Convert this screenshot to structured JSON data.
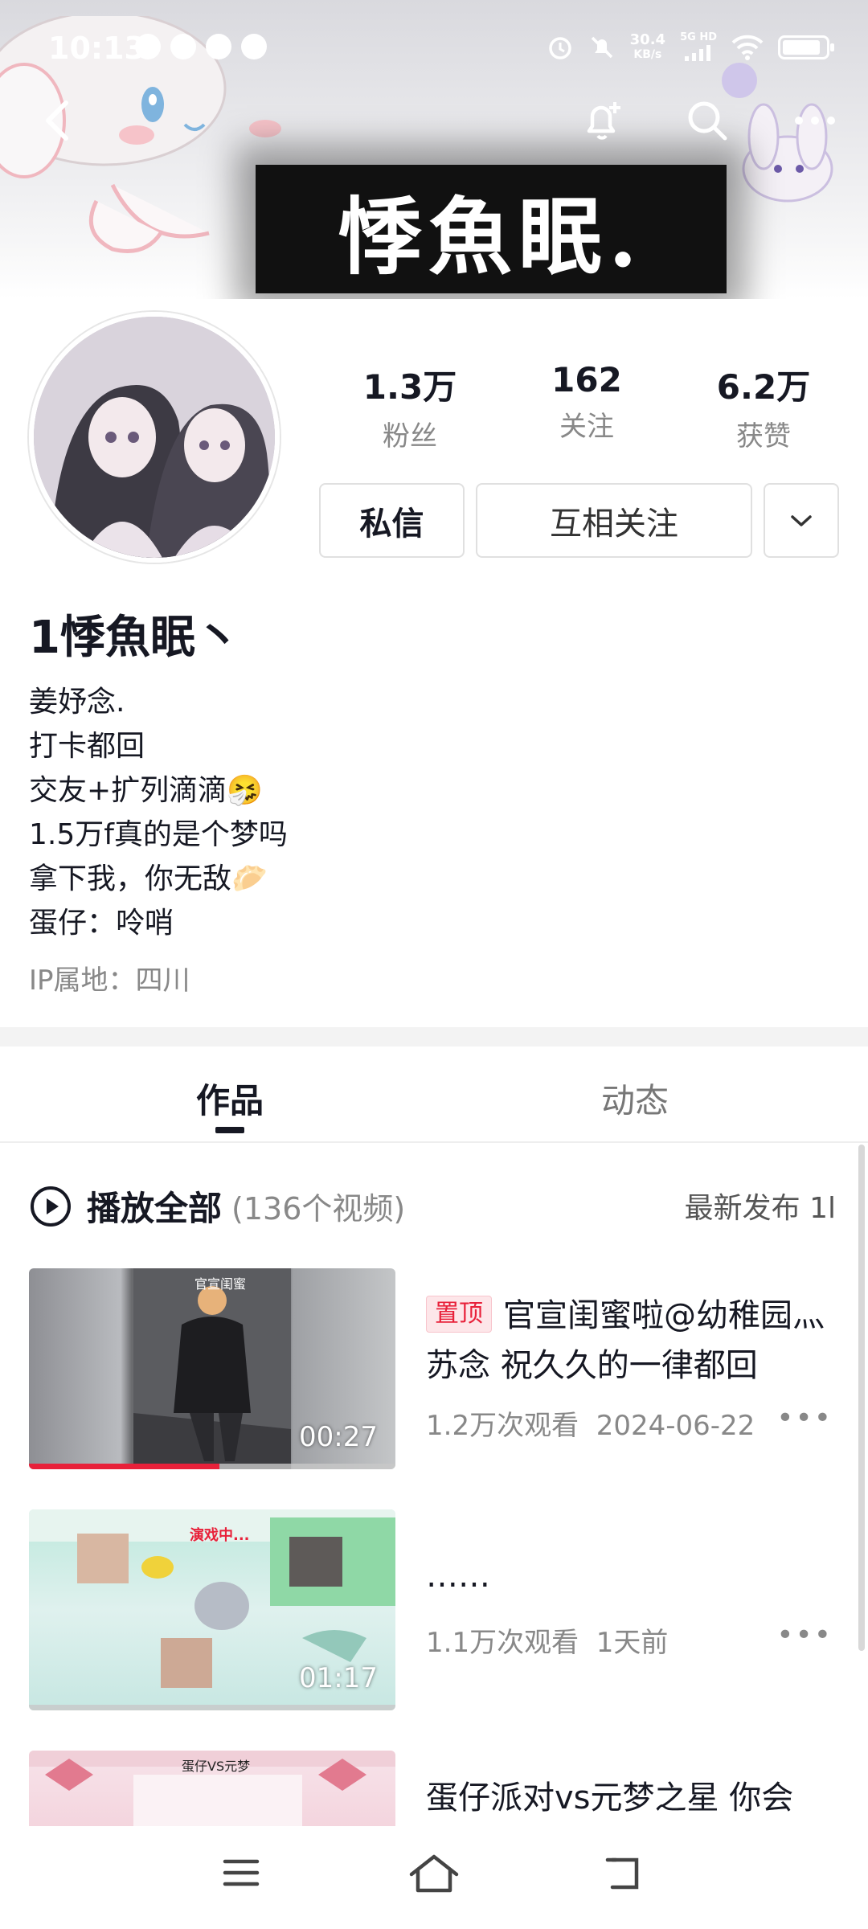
{
  "status_bar": {
    "time": "10:13",
    "network_speed_value": "30.4",
    "network_speed_unit": "KB/s",
    "network_type": "5G HD"
  },
  "header": {
    "banner_text": "悸魚眠."
  },
  "stats": [
    {
      "value": "1.3万",
      "label": "粉丝"
    },
    {
      "value": "162",
      "label": "关注"
    },
    {
      "value": "6.2万",
      "label": "获赞"
    }
  ],
  "actions": {
    "message": "私信",
    "mutual_follow": "互相关注"
  },
  "profile": {
    "nickname": "1悸魚眠丶",
    "bio_lines": [
      "姜妤念.",
      "打卡都回",
      "交友+扩列滴滴🤧",
      "1.5万f真的是个梦吗",
      "拿下我，你无敌🥟",
      "蛋仔：呤哨"
    ],
    "ip_location": "IP属地：四川"
  },
  "tabs": {
    "works": "作品",
    "feed": "动态"
  },
  "play_all": {
    "label": "播放全部",
    "count": "(136个视频)",
    "sort": "最新发布 1l"
  },
  "videos": [
    {
      "pinned_label": "置顶",
      "title": "官宣闺蜜啦@幼稚园灬苏念 祝久久的一律都回",
      "views": "1.2万次观看",
      "date": "2024-06-22",
      "duration": "00:27",
      "thumb_caption": "官宣闺蜜",
      "progress": 0.52
    },
    {
      "title": "……",
      "views": "1.1万次观看",
      "date": "1天前",
      "duration": "01:17",
      "thumb_caption": "演戏中..."
    },
    {
      "title": "蛋仔派对vs元梦之星 你会",
      "thumb_caption": "蛋仔VS元梦"
    }
  ]
}
